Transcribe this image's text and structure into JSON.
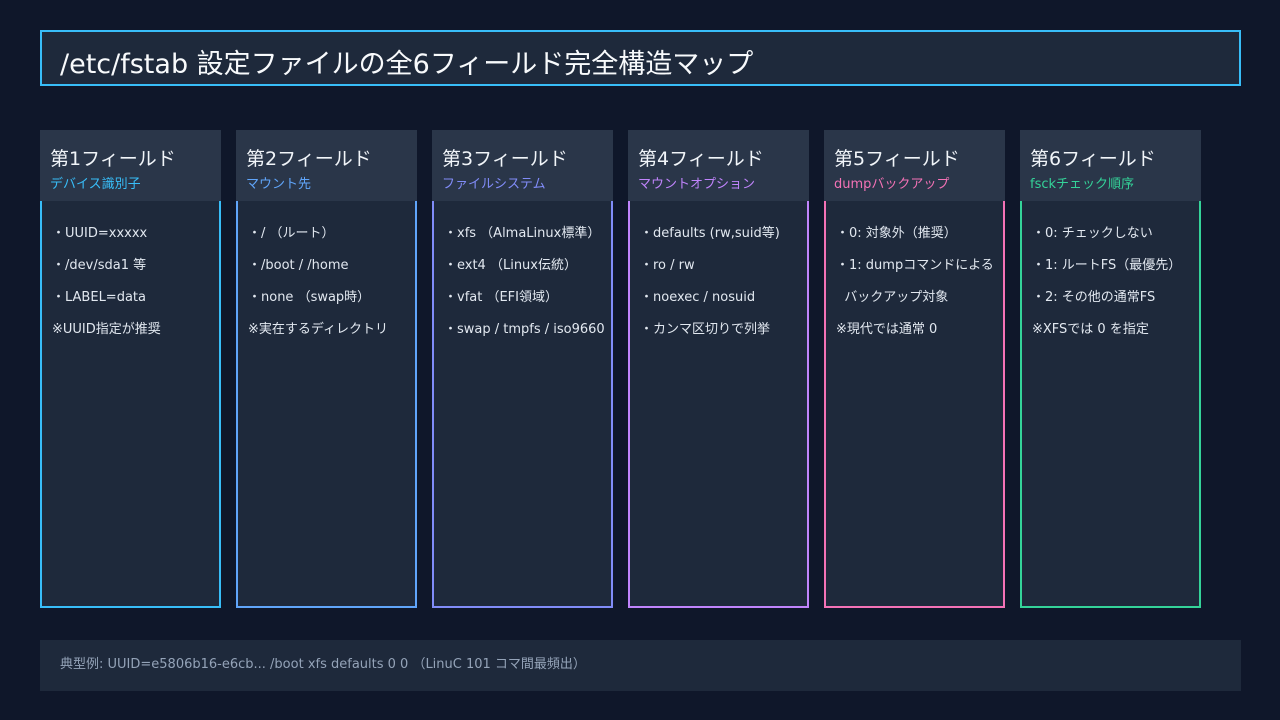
{
  "title": "/etc/fstab 設定ファイルの全6フィールド完全構造マップ",
  "fields": [
    {
      "name": "第1フィールド",
      "subtitle": "デバイス識別子",
      "color": "#38bdf8",
      "lines": [
        "・UUID=xxxxx",
        "・/dev/sda1 等",
        "・LABEL=data",
        "※UUID指定が推奨"
      ]
    },
    {
      "name": "第2フィールド",
      "subtitle": "マウント先",
      "color": "#60a5fa",
      "lines": [
        "・/ （ルート）",
        "・/boot / /home",
        "・none （swap時）",
        "※実在するディレクトリ"
      ]
    },
    {
      "name": "第3フィールド",
      "subtitle": "ファイルシステム",
      "color": "#818cf8",
      "lines": [
        "・xfs （AlmaLinux標準）",
        "・ext4 （Linux伝統）",
        "・vfat （EFI領域）",
        "・swap / tmpfs / iso9660"
      ]
    },
    {
      "name": "第4フィールド",
      "subtitle": "マウントオプション",
      "color": "#c084fc",
      "lines": [
        "・defaults (rw,suid等)",
        "・ro / rw",
        "・noexec / nosuid",
        "・カンマ区切りで列挙"
      ]
    },
    {
      "name": "第5フィールド",
      "subtitle": "dumpバックアップ",
      "color": "#f472b6",
      "lines": [
        "・0: 対象外（推奨）",
        "・1: dumpコマンドによる",
        "  バックアップ対象",
        "※現代では通常 0"
      ]
    },
    {
      "name": "第6フィールド",
      "subtitle": "fsckチェック順序",
      "color": "#34d399",
      "lines": [
        "・0: チェックしない",
        "・1: ルートFS（最優先）",
        "・2: その他の通常FS",
        "※XFSでは 0 を指定"
      ]
    }
  ],
  "footer": "典型例: UUID=e5806b16-e6cb...  /boot  xfs  defaults  0  0 （LinuC 101 コマ間最頻出）"
}
